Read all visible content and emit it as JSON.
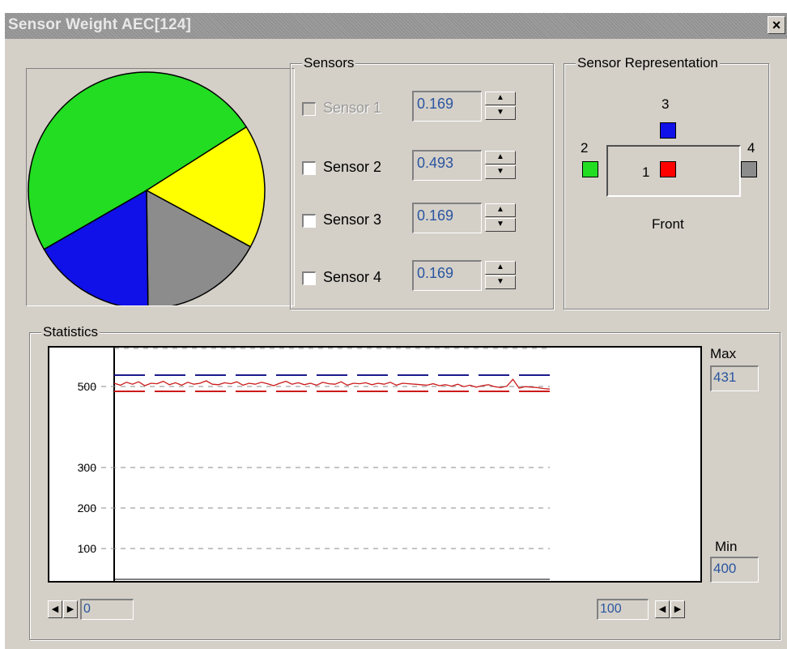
{
  "window": {
    "title": "Sensor Weight AEC[124]",
    "close_glyph": "×"
  },
  "pie": {
    "slices": [
      {
        "sensor": "Sensor 2",
        "value": 0.493,
        "color": "#22dd22"
      },
      {
        "sensor": "Sensor 1",
        "value": 0.169,
        "color": "#ffff00"
      },
      {
        "sensor": "Sensor 4",
        "value": 0.169,
        "color": "#8c8c8c"
      },
      {
        "sensor": "Sensor 3",
        "value": 0.169,
        "color": "#1010e8"
      }
    ]
  },
  "sensors": {
    "title": "Sensors",
    "items": [
      {
        "label": "Sensor 1",
        "value": "0.169",
        "checked": false,
        "disabled": true
      },
      {
        "label": "Sensor 2",
        "value": "0.493",
        "checked": false,
        "disabled": false
      },
      {
        "label": "Sensor 3",
        "value": "0.169",
        "checked": false,
        "disabled": false
      },
      {
        "label": "Sensor 4",
        "value": "0.169",
        "checked": false,
        "disabled": false
      }
    ],
    "spin_up_icon": "arrow-up-icon",
    "spin_down_icon": "arrow-down-icon"
  },
  "representation": {
    "title": "Sensor Representation",
    "label_1": "1",
    "label_2": "2",
    "label_3": "3",
    "label_4": "4",
    "front_label": "Front",
    "colors": {
      "s1": "#ff0000",
      "s2": "#22dd22",
      "s3": "#1010e8",
      "s4": "#8c8c8c"
    }
  },
  "statistics": {
    "title": "Statistics",
    "max_label": "Max",
    "max_value": "431",
    "min_label": "Min",
    "min_value": "400",
    "scroll_left_value": "0",
    "scroll_right_value": "100",
    "colors": {
      "limits": "#1a1a8c",
      "signal": "#cc1a1a",
      "limits_low": "#cc1a1a"
    }
  },
  "chart_data": {
    "type": "line",
    "title": "",
    "xlabel": "",
    "ylabel": "",
    "yticks": [
      "500",
      "300",
      "200",
      "100"
    ],
    "x_range": [
      0,
      100
    ],
    "series": [
      {
        "values": [
          470,
          466,
          472,
          468,
          473,
          465,
          470,
          469,
          474,
          467,
          471,
          466,
          472,
          468,
          470,
          475,
          468,
          467,
          471,
          469,
          473,
          466,
          470,
          468,
          472,
          469,
          465,
          470,
          474,
          468,
          471,
          467,
          470,
          466,
          472,
          469,
          468,
          473,
          466,
          470,
          469,
          471,
          467,
          470,
          468,
          472,
          466,
          470,
          469,
          468,
          467,
          466,
          469,
          465,
          467,
          464,
          468,
          463,
          466,
          462,
          465,
          467,
          463,
          461,
          464,
          478,
          460,
          463,
          462,
          461,
          459,
          458
        ]
      }
    ],
    "reference_lines": [
      {
        "value": 512
      },
      {
        "value": 455
      }
    ],
    "gridlines": [
      500,
      300,
      200,
      100
    ],
    "grid": true
  }
}
